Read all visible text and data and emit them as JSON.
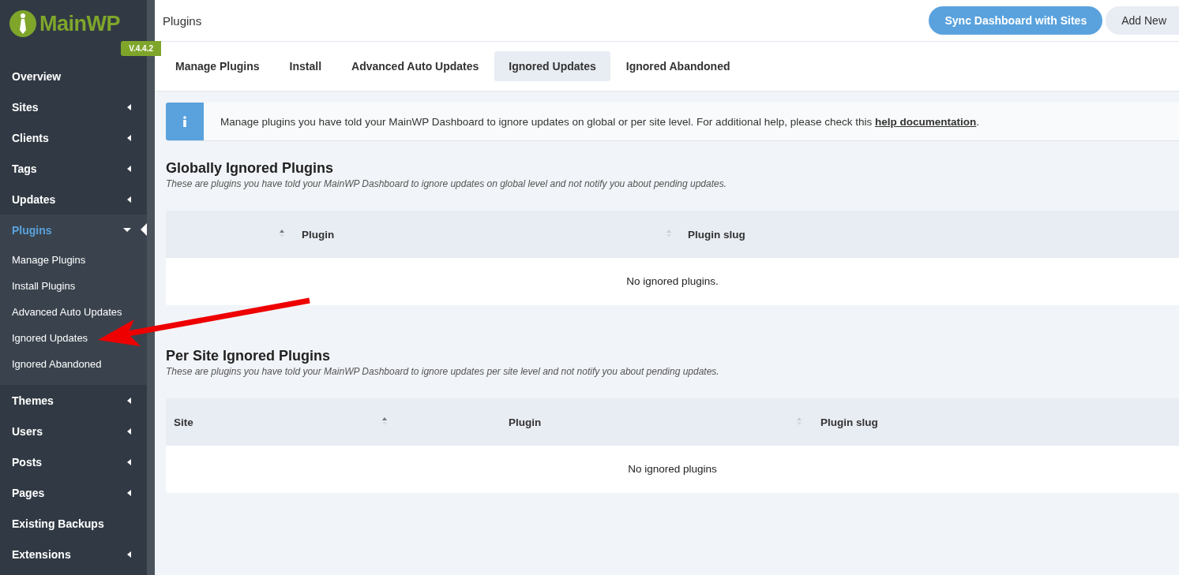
{
  "sidebar": {
    "logo": "MainWP",
    "version": "V.4.4.2",
    "items": [
      {
        "label": "Overview",
        "has_submenu": false,
        "selected": false
      },
      {
        "label": "Sites",
        "has_submenu": true,
        "expanded": false,
        "selected": false
      },
      {
        "label": "Clients",
        "has_submenu": true,
        "expanded": false,
        "selected": false
      },
      {
        "label": "Tags",
        "has_submenu": true,
        "expanded": false,
        "selected": false
      },
      {
        "label": "Updates",
        "has_submenu": true,
        "expanded": false,
        "selected": false
      },
      {
        "label": "Plugins",
        "has_submenu": true,
        "expanded": true,
        "selected": true,
        "children": [
          {
            "label": "Manage Plugins"
          },
          {
            "label": "Install Plugins"
          },
          {
            "label": "Advanced Auto Updates"
          },
          {
            "label": "Ignored Updates"
          },
          {
            "label": "Ignored Abandoned"
          }
        ]
      },
      {
        "label": "Themes",
        "has_submenu": true,
        "expanded": false,
        "selected": false
      },
      {
        "label": "Users",
        "has_submenu": true,
        "expanded": false,
        "selected": false
      },
      {
        "label": "Posts",
        "has_submenu": true,
        "expanded": false,
        "selected": false
      },
      {
        "label": "Pages",
        "has_submenu": true,
        "expanded": false,
        "selected": false
      },
      {
        "label": "Existing Backups",
        "has_submenu": false,
        "selected": false
      },
      {
        "label": "Extensions",
        "has_submenu": true,
        "expanded": false,
        "selected": false
      }
    ]
  },
  "header": {
    "title": "Plugins",
    "buttons": [
      {
        "label": "Sync Dashboard with Sites",
        "kind": "primary"
      },
      {
        "label": "Add New",
        "kind": "secondary"
      }
    ]
  },
  "tabs": [
    {
      "label": "Manage Plugins",
      "selected": false
    },
    {
      "label": "Install",
      "selected": false
    },
    {
      "label": "Advanced Auto Updates",
      "selected": false
    },
    {
      "label": "Ignored Updates",
      "selected": true
    },
    {
      "label": "Ignored Abandoned",
      "selected": false
    }
  ],
  "notice": {
    "text": "Manage plugins you have told your MainWP Dashboard to ignore updates on global or per site level. For additional help, please check this ",
    "link": "help documentation",
    "after": "."
  },
  "sections": [
    {
      "title": "Globally Ignored Plugins",
      "description": "These are plugins you have told your MainWP Dashboard to ignore updates on global level and not notify you about pending updates.",
      "columns": [
        {
          "sortable": true,
          "sorted": true
        },
        {
          "label": "Plugin",
          "sortable": true,
          "sorted": false
        },
        {
          "label": "Plugin slug",
          "sortable": false
        }
      ],
      "empty": "No ignored plugins."
    },
    {
      "title": "Per Site Ignored Plugins",
      "description": "These are plugins you have told your MainWP Dashboard to ignore updates per site level and not notify you about pending updates.",
      "columns": [
        {
          "label": "Site",
          "sortable": true,
          "sorted": true
        },
        {
          "label": "Plugin",
          "sortable": true,
          "sorted": false
        },
        {
          "label": "Plugin slug",
          "sortable": false
        }
      ],
      "empty": "No ignored plugins"
    }
  ]
}
